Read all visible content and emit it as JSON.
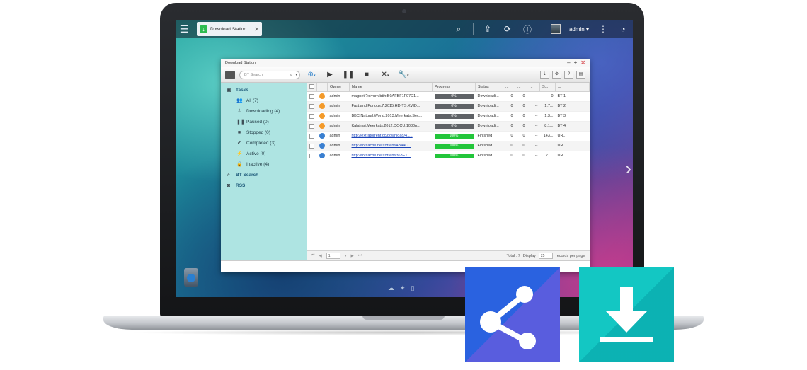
{
  "topbar": {
    "app_tab_title": "Download Station",
    "user_name": "admin"
  },
  "window": {
    "title": "Download Station",
    "search_placeholder": "BT Search"
  },
  "sidebar": {
    "tasks_label": "Tasks",
    "items": [
      {
        "label": "All (7)",
        "icon": "all-icon"
      },
      {
        "label": "Downloading (4)",
        "icon": "download-icon"
      },
      {
        "label": "Paused (0)",
        "icon": "pause-icon"
      },
      {
        "label": "Stopped (0)",
        "icon": "stop-icon"
      },
      {
        "label": "Completed (3)",
        "icon": "check-icon"
      },
      {
        "label": "Active (0)",
        "icon": "lightning-icon"
      },
      {
        "label": "Inactive (4)",
        "icon": "lock-icon"
      }
    ],
    "bt_search_label": "BT Search",
    "rss_label": "RSS"
  },
  "table": {
    "headers": [
      "",
      "",
      "Owner",
      "Name",
      "Progress",
      "Status",
      "...",
      "...",
      "...",
      "S...",
      "..."
    ],
    "rows": [
      {
        "owner": "admin",
        "name": "magnet:?xt=urn:btih:B0AFBF1F07D1...",
        "progress": 0,
        "progress_label": "0%",
        "status": "Downloadi...",
        "c1": "0",
        "c2": "0",
        "c3": "--",
        "c4": "0",
        "c5": "BT 1",
        "kind": "downloading",
        "link": false
      },
      {
        "owner": "admin",
        "name": "Fast.and.Furious.7.2015.HD-TS.XVID...",
        "progress": 0,
        "progress_label": "0%",
        "status": "Downloadi...",
        "c1": "0",
        "c2": "0",
        "c3": "--",
        "c4": "1.7...",
        "c5": "BT 2",
        "kind": "downloading",
        "link": false
      },
      {
        "owner": "admin",
        "name": "BBC.Natural.World.2013.Meerkats.Sec...",
        "progress": 0,
        "progress_label": "0%",
        "status": "Downloadi...",
        "c1": "0",
        "c2": "0",
        "c3": "--",
        "c4": "1.3...",
        "c5": "BT 3",
        "kind": "downloading",
        "link": false
      },
      {
        "owner": "admin",
        "name": "Kalahari.Meerkats.2012.DOCU.1080p...",
        "progress": 0,
        "progress_label": "0%",
        "status": "Downloadi...",
        "c1": "0",
        "c2": "0",
        "c3": "--",
        "c4": "8.1...",
        "c5": "BT 4",
        "kind": "downloading",
        "link": false
      },
      {
        "owner": "admin",
        "name": "http://extratorrent.cc/download/41...",
        "progress": 100,
        "progress_label": "100%",
        "status": "Finished",
        "c1": "0",
        "c2": "0",
        "c3": "--",
        "c4": "143...",
        "c5": "UR...",
        "kind": "finished",
        "link": true
      },
      {
        "owner": "admin",
        "name": "http://torcache.net/torrent/4B44C...",
        "progress": 100,
        "progress_label": "100%",
        "status": "Finished",
        "c1": "0",
        "c2": "0",
        "c3": "--",
        "c4": "...",
        "c5": "UR...",
        "kind": "finished",
        "link": true
      },
      {
        "owner": "admin",
        "name": "http://torcache.net/torrent/363E1...",
        "progress": 100,
        "progress_label": "100%",
        "status": "Finished",
        "c1": "0",
        "c2": "0",
        "c3": "--",
        "c4": "21...",
        "c5": "UR...",
        "kind": "finished",
        "link": true
      }
    ]
  },
  "pager": {
    "page": "1",
    "total": "Total : 7",
    "display_label": "Display",
    "display_value": "25",
    "per_page_label": "records per page"
  },
  "colors": {
    "downloading": "#f39a2a",
    "finished": "#3a7fd0",
    "progress_fill": "#22c53a",
    "share_tile": "#2a62e0",
    "download_tile": "#13c7c3"
  }
}
